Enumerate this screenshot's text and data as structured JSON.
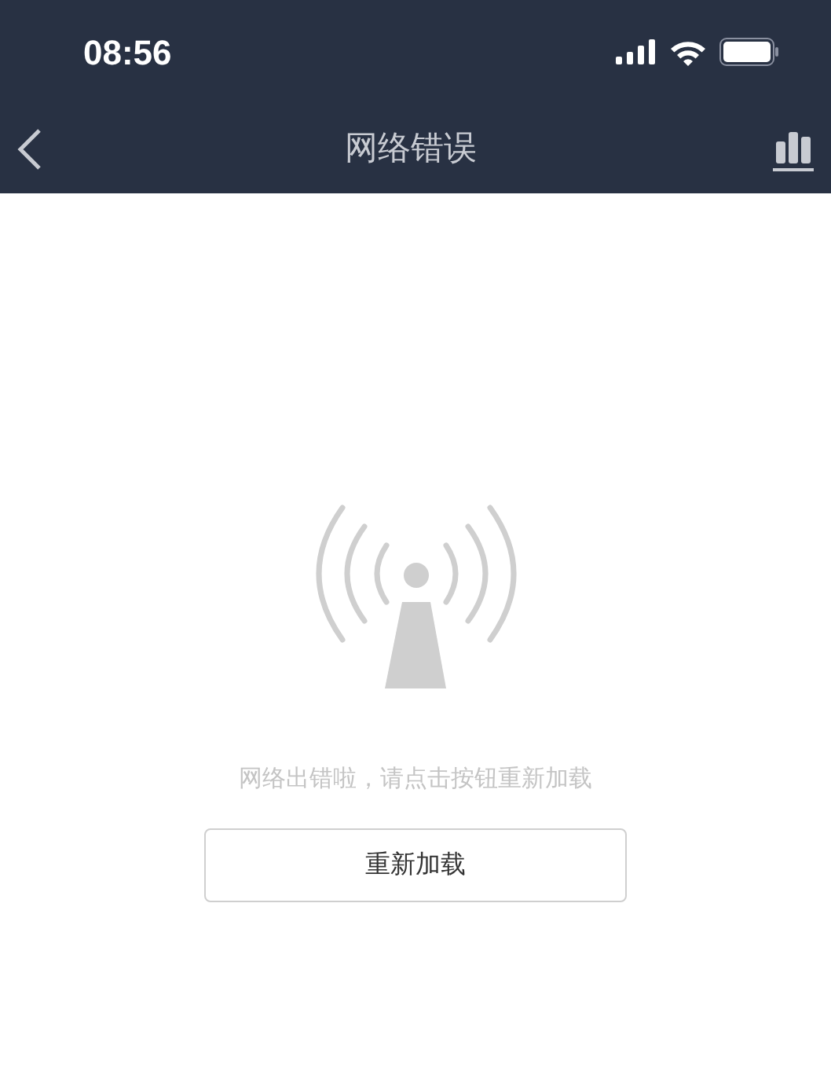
{
  "status_bar": {
    "time": "08:56"
  },
  "nav_bar": {
    "title": "网络错误"
  },
  "error": {
    "message": "网络出错啦，请点击按钮重新加载",
    "button": "重新加载"
  }
}
